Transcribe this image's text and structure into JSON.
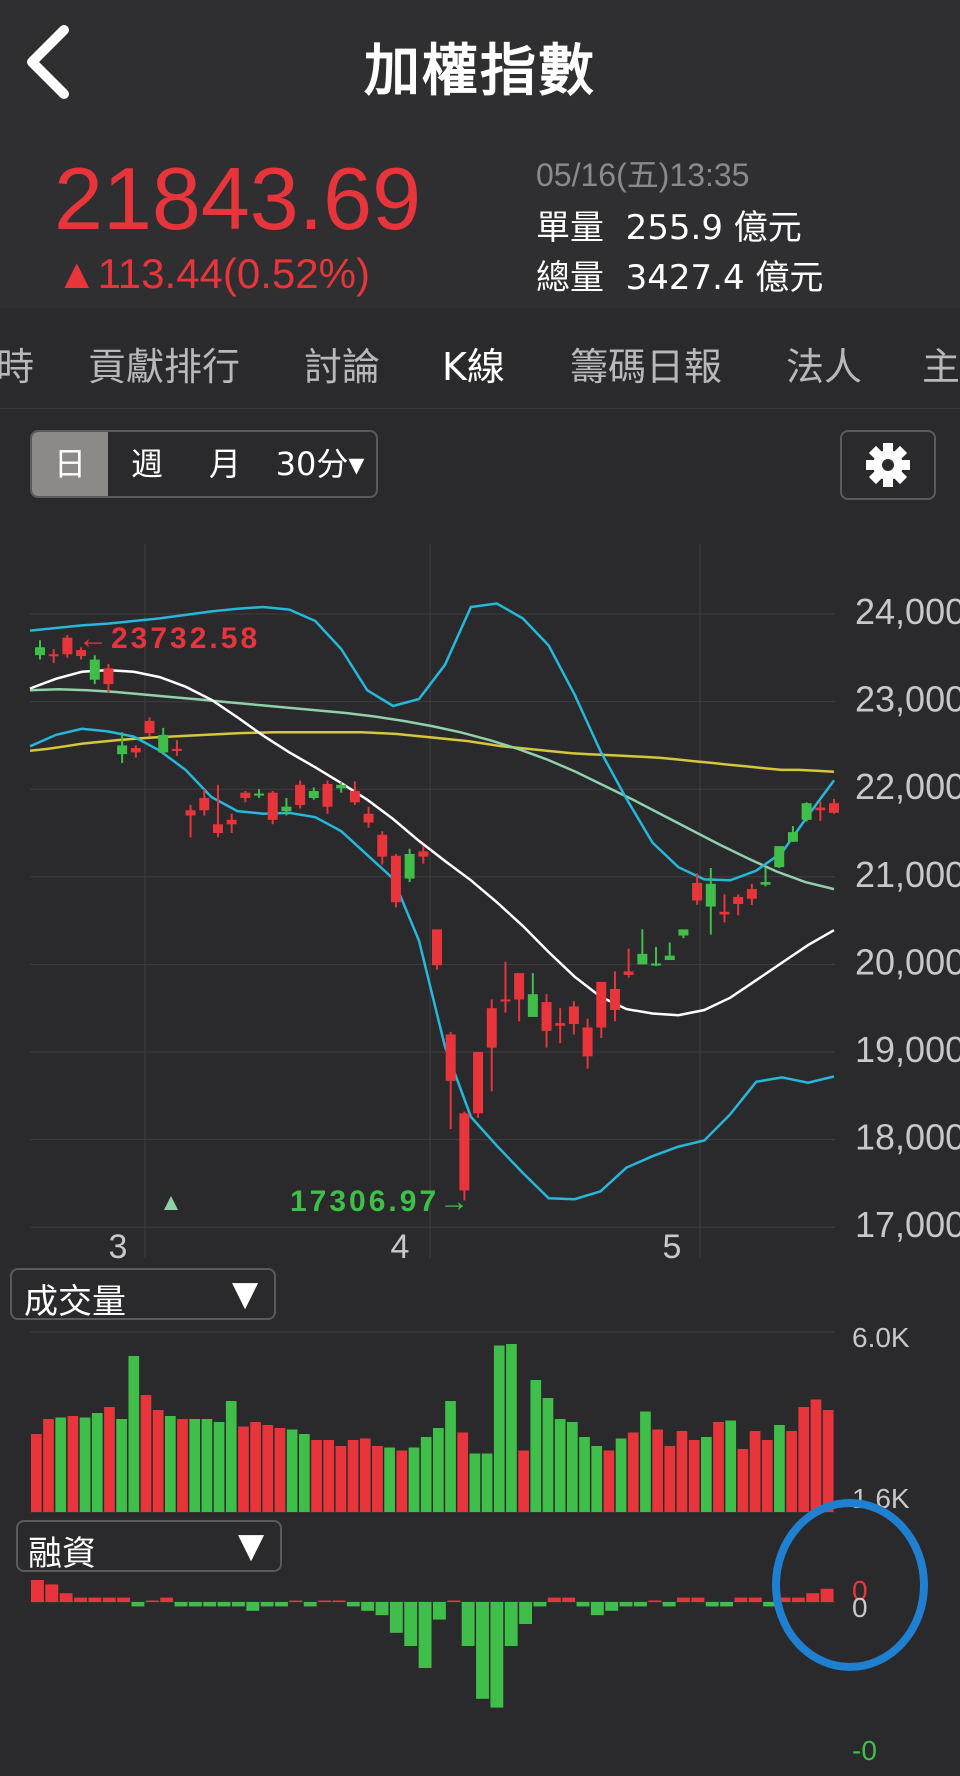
{
  "header": {
    "title": "加權指數",
    "back_icon": "chevron-left-icon"
  },
  "quote": {
    "price": "21843.69",
    "change": "▲113.44(0.52%)",
    "time": "05/16(五)13:35",
    "unit_volume_label": "單量",
    "unit_volume_value": "255.9 億元",
    "total_volume_label": "總量",
    "total_volume_value": "3427.4 億元",
    "up_color": "#e8353b"
  },
  "tabs": [
    {
      "label": "時"
    },
    {
      "label": "貢獻排行"
    },
    {
      "label": "討論"
    },
    {
      "label": "K線",
      "active": true
    },
    {
      "label": "籌碼日報"
    },
    {
      "label": "法人"
    },
    {
      "label": "主"
    }
  ],
  "periods": {
    "day": "日",
    "week": "週",
    "month": "月",
    "min30": "30分▾"
  },
  "settings_icon": "gear-icon",
  "chart_data": [
    {
      "type": "candlestick",
      "x_tick_labels": [
        "3",
        "4",
        "5"
      ],
      "y_tick_labels": [
        "24,000",
        "23,000",
        "22,000",
        "21,000",
        "20,000",
        "19,000",
        "18,000",
        "17,000"
      ],
      "ylim": [
        17000,
        24300
      ],
      "high_marker": "←23732.58",
      "low_marker": "17306.97→",
      "ohlc": [
        [
          23620,
          23700,
          23480,
          23530
        ],
        [
          23520,
          23600,
          23440,
          23540
        ],
        [
          23540,
          23760,
          23500,
          23730
        ],
        [
          23520,
          23620,
          23480,
          23590
        ],
        [
          23480,
          23530,
          23200,
          23250
        ],
        [
          23200,
          23430,
          23100,
          23380
        ],
        [
          22500,
          22650,
          22300,
          22400
        ],
        [
          22420,
          22500,
          22360,
          22470
        ],
        [
          22640,
          22820,
          22600,
          22780
        ],
        [
          22620,
          22700,
          22400,
          22420
        ],
        [
          22450,
          22560,
          22380,
          22460
        ],
        [
          21700,
          21820,
          21450,
          21760
        ],
        [
          21760,
          22000,
          21700,
          21900
        ],
        [
          21500,
          22050,
          21450,
          21600
        ],
        [
          21600,
          21720,
          21500,
          21650
        ],
        [
          21900,
          21980,
          21850,
          21960
        ],
        [
          21950,
          22000,
          21900,
          21940
        ],
        [
          21650,
          21980,
          21600,
          21960
        ],
        [
          21800,
          21900,
          21700,
          21750
        ],
        [
          21820,
          22100,
          21780,
          22050
        ],
        [
          21980,
          22020,
          21880,
          21900
        ],
        [
          21800,
          22100,
          21720,
          22060
        ],
        [
          22050,
          22080,
          21960,
          22010
        ],
        [
          21850,
          22090,
          21820,
          21980
        ],
        [
          21620,
          21800,
          21560,
          21720
        ],
        [
          21230,
          21520,
          21140,
          21480
        ],
        [
          20710,
          21260,
          20650,
          21240
        ],
        [
          21260,
          21320,
          20940,
          20980
        ],
        [
          21230,
          21350,
          21150,
          21290
        ],
        [
          19990,
          20380,
          19940,
          20400
        ],
        [
          18670,
          19230,
          18120,
          19200
        ],
        [
          17420,
          18320,
          17306,
          18300
        ],
        [
          18300,
          19000,
          18250,
          19000
        ],
        [
          19050,
          19600,
          18550,
          19500
        ],
        [
          19600,
          20030,
          19450,
          19600
        ],
        [
          19600,
          19900,
          19350,
          19900
        ],
        [
          19660,
          19900,
          19450,
          19400
        ],
        [
          19240,
          19660,
          19050,
          19570
        ],
        [
          19300,
          19500,
          19100,
          19330
        ],
        [
          19320,
          19580,
          19200,
          19520
        ],
        [
          18950,
          19380,
          18810,
          19280
        ],
        [
          19280,
          19800,
          19160,
          19800
        ],
        [
          19480,
          19920,
          19350,
          19720
        ],
        [
          19880,
          20180,
          19850,
          19920
        ],
        [
          20120,
          20400,
          20050,
          20000
        ],
        [
          20010,
          20200,
          19980,
          20000
        ],
        [
          20100,
          20250,
          20050,
          20050
        ],
        [
          20400,
          20380,
          20300,
          20330
        ],
        [
          20730,
          21040,
          20680,
          20930
        ],
        [
          20920,
          21100,
          20340,
          20660
        ],
        [
          20570,
          20800,
          20480,
          20600
        ],
        [
          20690,
          20800,
          20560,
          20770
        ],
        [
          20750,
          20920,
          20680,
          20860
        ],
        [
          20940,
          21100,
          20890,
          20910
        ],
        [
          21350,
          21350,
          21100,
          21110
        ],
        [
          21510,
          21580,
          21400,
          21400
        ],
        [
          21840,
          21850,
          21630,
          21650
        ],
        [
          21760,
          21860,
          21640,
          21790
        ],
        [
          21730,
          21890,
          21720,
          21840
        ]
      ],
      "ma_yellow": [
        22440,
        22460,
        22490,
        22520,
        22540,
        22560,
        22575,
        22590,
        22600,
        22610,
        22620,
        22630,
        22640,
        22645,
        22650,
        22650,
        22650,
        22650,
        22650,
        22650,
        22640,
        22630,
        22610,
        22590,
        22570,
        22550,
        22520,
        22490,
        22470,
        22450,
        22430,
        22410,
        22400,
        22390,
        22380,
        22370,
        22360,
        22340,
        22320,
        22300,
        22280,
        22260,
        22240,
        22220,
        22220,
        22210,
        22200
      ],
      "ma_green": [
        23130,
        23140,
        23130,
        23110,
        23080,
        23050,
        23020,
        22990,
        22960,
        22930,
        22900,
        22870,
        22830,
        22780,
        22720,
        22650,
        22560,
        22460,
        22340,
        22200,
        22040,
        21880,
        21710,
        21540,
        21370,
        21210,
        21060,
        20940,
        20860
      ],
      "ma_white": [
        23150,
        23260,
        23340,
        23360,
        23340,
        23280,
        23170,
        23020,
        22820,
        22610,
        22420,
        22250,
        22070,
        21880,
        21660,
        21410,
        21180,
        20960,
        20710,
        20440,
        20140,
        19860,
        19630,
        19490,
        19440,
        19420,
        19480,
        19620,
        19820,
        20020,
        20220,
        20390
      ],
      "bb_upper": [
        23810,
        23840,
        23870,
        23890,
        23920,
        23950,
        23990,
        24030,
        24060,
        24080,
        24050,
        23920,
        23600,
        23130,
        22950,
        23030,
        23420,
        24080,
        24120,
        23950,
        23640,
        23080,
        22430,
        21890,
        21390,
        21110,
        20970,
        20960,
        21070,
        21280,
        21700,
        22100
      ],
      "bb_lower": [
        22490,
        22620,
        22690,
        22660,
        22600,
        22440,
        22220,
        21910,
        21750,
        21720,
        21730,
        21680,
        21520,
        21250,
        20980,
        20270,
        19060,
        18260,
        17930,
        17620,
        17330,
        17320,
        17410,
        17680,
        17810,
        17920,
        17990,
        18290,
        18660,
        18710,
        18650,
        18720
      ],
      "markers": {
        "up_triangle": "▲"
      }
    },
    {
      "type": "bar",
      "title": "成交量",
      "y_tick_labels": [
        "6.0K",
        "1.6K"
      ],
      "values": [
        2600,
        3100,
        3150,
        3200,
        3150,
        3300,
        3500,
        3100,
        5200,
        3900,
        3400,
        3200,
        3100,
        3100,
        3100,
        3000,
        3700,
        2850,
        3000,
        2900,
        2800,
        2750,
        2600,
        2400,
        2400,
        2200,
        2400,
        2450,
        2200,
        2150,
        2050,
        2150,
        2500,
        2800,
        3700,
        2650,
        1950,
        1950,
        5550,
        5600,
        2050,
        4400,
        3800,
        3100,
        3000,
        2500,
        2200,
        2050,
        2450,
        2650,
        3350,
        2750,
        2200,
        2700,
        2400,
        2500,
        3000,
        3050,
        2100,
        2700,
        2400,
        2900,
        2700,
        3500,
        3750,
        3400
      ],
      "colors": [
        "r",
        "r",
        "g",
        "r",
        "g",
        "g",
        "r",
        "g",
        "g",
        "r",
        "r",
        "g",
        "r",
        "g",
        "g",
        "g",
        "g",
        "r",
        "r",
        "r",
        "r",
        "g",
        "g",
        "r",
        "r",
        "r",
        "r",
        "r",
        "r",
        "g",
        "r",
        "g",
        "g",
        "g",
        "g",
        "r",
        "g",
        "g",
        "g",
        "g",
        "r",
        "g",
        "g",
        "g",
        "g",
        "g",
        "g",
        "r",
        "g",
        "r",
        "g",
        "r",
        "r",
        "r",
        "r",
        "g",
        "r",
        "g",
        "r",
        "r",
        "r",
        "g",
        "r",
        "r",
        "r",
        "r"
      ]
    },
    {
      "type": "bar",
      "title": "融資",
      "y_tick_labels": [
        "0",
        "0",
        "-0"
      ],
      "values": [
        5,
        4,
        2,
        1,
        1,
        1,
        1,
        -1,
        0,
        1,
        -1,
        -1,
        -1,
        -1,
        -1,
        -2,
        -1,
        -1,
        0,
        -1,
        0,
        0,
        -1,
        -2,
        -3,
        -7,
        -10,
        -15,
        -4,
        0,
        -10,
        -22,
        -24,
        -10,
        -5,
        -1,
        1,
        1,
        -1,
        -3,
        -2,
        -1,
        -1,
        0,
        -1,
        1,
        1,
        -1,
        -1,
        1,
        1,
        -1,
        1,
        1,
        2,
        3
      ],
      "colors": [
        "r",
        "r",
        "r",
        "r",
        "r",
        "r",
        "r",
        "g",
        "r",
        "r",
        "g",
        "g",
        "g",
        "g",
        "g",
        "g",
        "g",
        "g",
        "r",
        "g",
        "r",
        "r",
        "g",
        "g",
        "g",
        "g",
        "g",
        "g",
        "g",
        "r",
        "g",
        "g",
        "g",
        "g",
        "g",
        "g",
        "r",
        "r",
        "g",
        "g",
        "g",
        "g",
        "g",
        "r",
        "g",
        "r",
        "r",
        "g",
        "g",
        "r",
        "r",
        "g",
        "r",
        "r",
        "r",
        "r"
      ]
    }
  ]
}
